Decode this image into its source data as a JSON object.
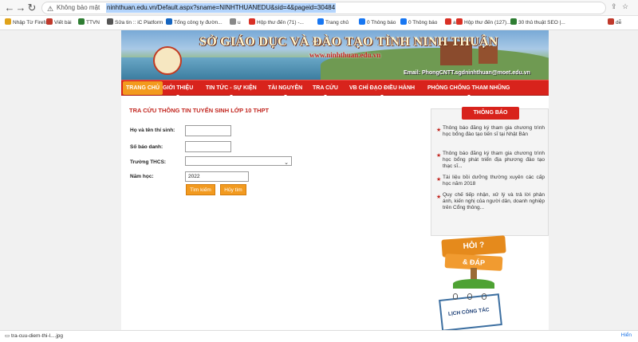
{
  "browser": {
    "security_label": "Không bảo mật",
    "url_selected": "ninhthuan.edu.vn",
    "url_rest": "/Default.aspx?sname=NINHTHUANEDU&sid=4&pageid=30484",
    "bookmarks": [
      {
        "label": "Nhập Từ Firefox",
        "color": "#e0a31a"
      },
      {
        "label": "Viết bài",
        "color": "#c0392b"
      },
      {
        "label": "TTVN",
        "color": "#2e7d32"
      },
      {
        "label": "Sửa tin :: iC Platform",
        "color": "#555555"
      },
      {
        "label": "Tổng công ty đườn...",
        "color": "#1565c0"
      },
      {
        "label": "u",
        "color": "#888888"
      },
      {
        "label": "Hộp thư đến (71) -...",
        "color": "#d93025"
      },
      {
        "label": "Trang chủ",
        "color": "#1877f2"
      },
      {
        "label": "0 Thông báo",
        "color": "#1877f2"
      },
      {
        "label": "0 Thông báo",
        "color": "#1877f2"
      },
      {
        "label": "a",
        "color": "#d93025"
      },
      {
        "label": "Hộp thư đến (127)...",
        "color": "#d93025"
      },
      {
        "label": "30 thủ thuật SEO |...",
        "color": "#2e7d32"
      },
      {
        "label": "dễ",
        "color": "#c0392b"
      }
    ]
  },
  "banner": {
    "title": "SỞ GIÁO DỤC VÀ ĐÀO TẠO TỈNH NINH THUẬN",
    "url": "www.ninhthuan.edu.vn",
    "email": "Email: PhongCNTT.sgdninhthuan@moet.edu.vn"
  },
  "menu": {
    "items": [
      "TRANG CHỦ",
      "GIỚI THIỆU",
      "TIN TỨC - SỰ KIỆN",
      "TÀI NGUYÊN",
      "TRA CỨU",
      "VB CHỈ ĐẠO ĐIỀU HÀNH",
      "PHÒNG CHỐNG THAM NHŨNG"
    ],
    "active": "TRANG CHỦ"
  },
  "form": {
    "title": "TRA CỨU THÔNG TIN TUYỂN SINH LỚP 10 THPT",
    "name_label": "Họ và tên thí sinh:",
    "name_value": "",
    "sbd_label": "Số báo danh:",
    "sbd_value": "",
    "school_label": "Trường THCS:",
    "school_value": "",
    "year_label": "Năm học:",
    "year_value": "2022",
    "search_button": "Tìm kiếm",
    "cancel_button": "Hủy tìm"
  },
  "sidebar": {
    "notice_header": "THÔNG BÁO",
    "notices": [
      "Thông báo đăng ký tham gia chương trình học bổng đào tạo tiến sĩ tại Nhật Bản",
      "Thông báo đăng ký tham gia chương trình học bổng phát triển địa phương đào tạo thạc sĩ...",
      "Tài liệu bồi dưỡng thường xuyên các cấp học năm 2018",
      "Quy chế tiếp nhận, xử lý và trả lời phản ánh, kiến nghị của người dân, doanh nghiệp trên Cổng thông..."
    ],
    "hoidap_top": "HỎI ?",
    "hoidap_bottom": "& ĐÁP",
    "lich_cong_tac": "LỊCH CÔNG TÁC"
  },
  "downloads": {
    "file_label": "tra-cuu-diem-thi-l....jpg",
    "show_all": "Hiển"
  }
}
